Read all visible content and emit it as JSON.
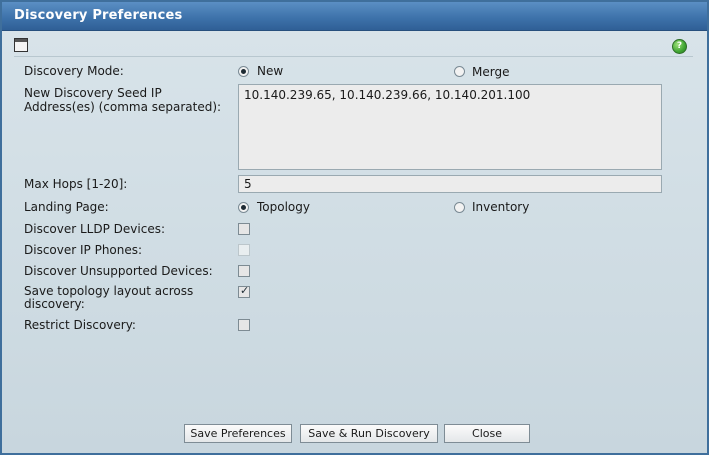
{
  "window": {
    "title": "Discovery Preferences"
  },
  "icons": {
    "document": "document-icon",
    "help": "help-icon",
    "help_glyph": "?"
  },
  "form": {
    "discovery_mode_label": "Discovery Mode:",
    "discovery_mode_options": [
      "New",
      "Merge"
    ],
    "discovery_mode_selected": "New",
    "seed_ip_label_line1": "New Discovery Seed IP",
    "seed_ip_label_line2": "Address(es) (comma separated):",
    "seed_ip_value": "10.140.239.65, 10.140.239.66, 10.140.201.100",
    "max_hops_label": "Max Hops [1-20]:",
    "max_hops_value": "5",
    "landing_page_label": "Landing Page:",
    "landing_page_options": [
      "Topology",
      "Inventory"
    ],
    "landing_page_selected": "Topology",
    "lldp_label": "Discover LLDP Devices:",
    "lldp_checked": false,
    "ip_phones_label": "Discover IP Phones:",
    "ip_phones_checked": false,
    "unsupported_label": "Discover Unsupported Devices:",
    "unsupported_checked": false,
    "save_layout_label_line1": "Save topology layout across",
    "save_layout_label_line2": "discovery:",
    "save_layout_checked": true,
    "restrict_label": "Restrict Discovery:",
    "restrict_checked": false
  },
  "buttons": {
    "save_preferences": "Save Preferences",
    "save_run": "Save & Run Discovery",
    "close": "Close"
  },
  "colors": {
    "titlebar": "#3e73ab",
    "help_icon": "#3fa532"
  }
}
